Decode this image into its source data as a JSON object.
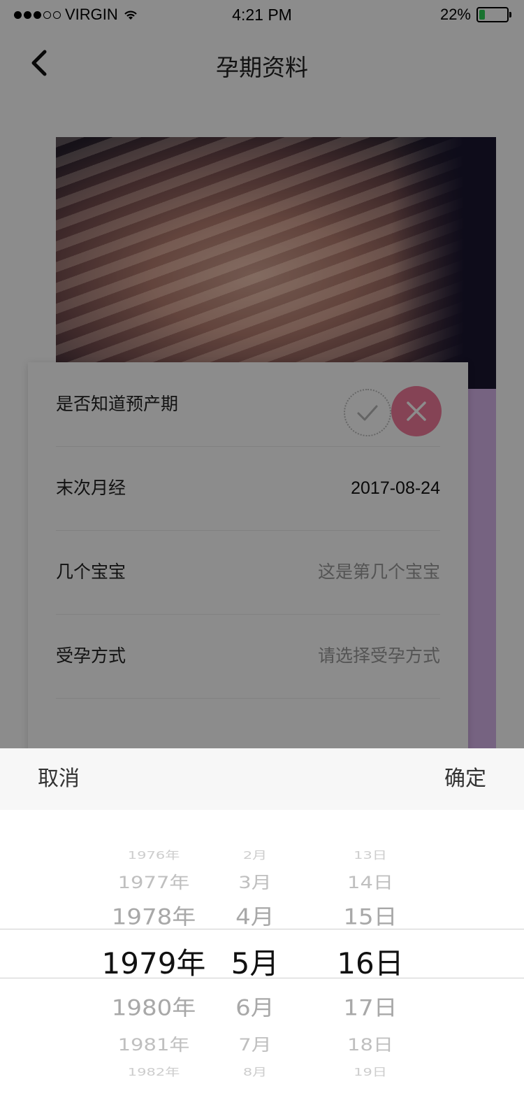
{
  "status_bar": {
    "carrier": "VIRGIN",
    "time": "4:21 PM",
    "battery_percent_text": "22%",
    "battery_level": 0.22
  },
  "navbar": {
    "title": "孕期资料",
    "back_icon": "chevron-left-icon"
  },
  "form": {
    "rows": [
      {
        "label": "是否知道预产期",
        "check_icon": "check-icon",
        "close_icon": "close-icon"
      },
      {
        "label": "末次月经",
        "value": "2017-08-24"
      },
      {
        "label": "几个宝宝",
        "placeholder": "这是第几个宝宝"
      },
      {
        "label": "受孕方式",
        "placeholder": "请选择受孕方式"
      }
    ]
  },
  "picker": {
    "cancel_label": "取消",
    "confirm_label": "确定",
    "years": [
      "1976年",
      "1977年",
      "1978年",
      "1979年",
      "1980年",
      "1981年",
      "1982年"
    ],
    "months": [
      "2月",
      "3月",
      "4月",
      "5月",
      "6月",
      "7月",
      "8月"
    ],
    "days": [
      "13日",
      "14日",
      "15日",
      "16日",
      "17日",
      "18日",
      "19日"
    ],
    "selected": {
      "year": "1979年",
      "month": "5月",
      "day": "16日"
    }
  },
  "colors": {
    "accent_pink": "#f27a9b",
    "purple_panel": "#d8b4ec",
    "battery_green": "#2fd158"
  }
}
